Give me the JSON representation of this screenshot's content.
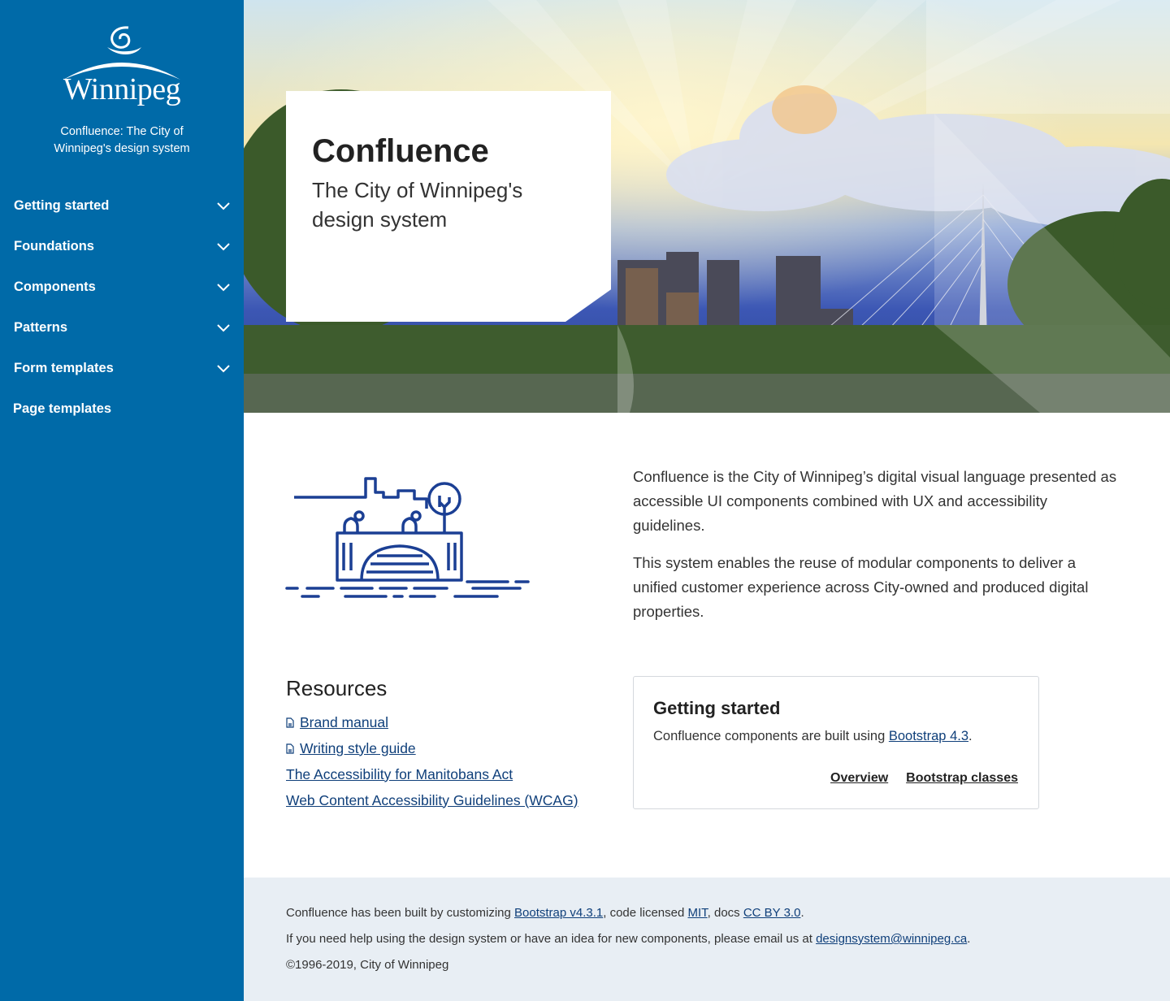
{
  "sidebar": {
    "logo_text": "Winnipeg",
    "tagline": "Confluence: The City of Winnipeg's design system",
    "items": [
      {
        "label": "Getting started"
      },
      {
        "label": "Foundations"
      },
      {
        "label": "Components"
      },
      {
        "label": "Patterns"
      },
      {
        "label": "Form templates"
      },
      {
        "label": "Page templates"
      }
    ]
  },
  "hero": {
    "title": "Confluence",
    "subtitle": "The City of Winnipeg's design system"
  },
  "intro": {
    "p1": "Confluence is the City of Winnipeg’s digital visual language presented as accessible UI components combined with UX and accessibility guidelines.",
    "p2": "This system enables the reuse of modular components to deliver a unified customer experience across City-owned and produced digital properties."
  },
  "resources": {
    "heading": "Resources",
    "links": [
      {
        "label": "Brand manual",
        "icon": "document-icon"
      },
      {
        "label": "Writing style guide",
        "icon": "document-icon"
      },
      {
        "label": "The Accessibility for Manitobans Act"
      },
      {
        "label": "Web Content Accessibility Guidelines (WCAG)"
      }
    ]
  },
  "getting_started": {
    "title": "Getting started",
    "text_before": "Confluence components are built using ",
    "link": "Bootstrap 4.3",
    "text_after": ".",
    "actions": [
      "Overview",
      "Bootstrap classes"
    ]
  },
  "footer": {
    "l1_a": "Confluence has been built by customizing ",
    "l1_link1": "Bootstrap v4.3.1",
    "l1_b": ", code licensed ",
    "l1_link2": "MIT",
    "l1_c": ", docs ",
    "l1_link3": "CC BY 3.0",
    "l1_d": ".",
    "l2_a": "If you need help using the design system or have an idea for new components, please email us at ",
    "l2_link": "designsystem@winnipeg.ca",
    "l2_b": ".",
    "l3": "©1996-2019, City of Winnipeg"
  },
  "colors": {
    "sidebar": "#006aa8",
    "link": "#0f3f7a",
    "illustration": "#1b3f94",
    "footer_bg": "#e8eef4"
  }
}
